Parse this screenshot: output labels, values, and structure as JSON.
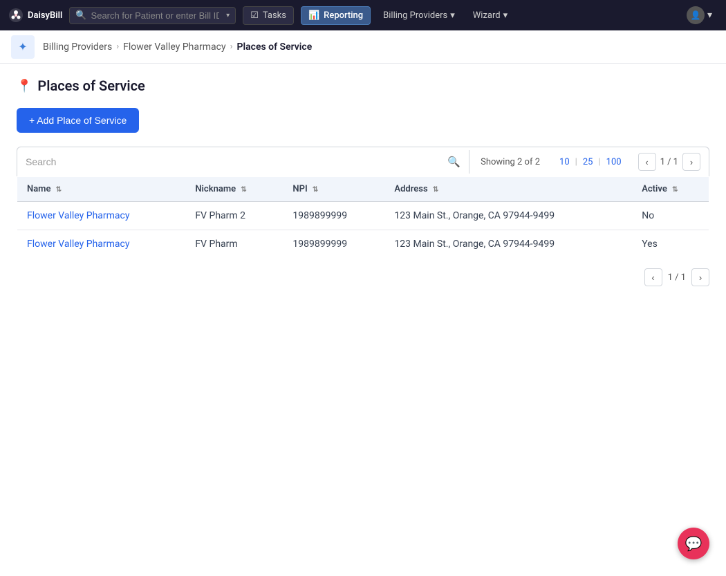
{
  "app": {
    "name": "DaisyBill"
  },
  "topnav": {
    "search_placeholder": "Search for Patient or enter Bill ID",
    "tasks_label": "Tasks",
    "reporting_label": "Reporting",
    "billing_providers_label": "Billing Providers",
    "wizard_label": "Wizard"
  },
  "breadcrumb": {
    "billing_providers": "Billing Providers",
    "pharmacy": "Flower Valley Pharmacy",
    "current": "Places of Service"
  },
  "page": {
    "title": "Places of Service",
    "add_button": "+ Add Place of Service"
  },
  "table_controls": {
    "search_placeholder": "Search",
    "showing": "Showing 2 of 2",
    "page_sizes": [
      "10",
      "25",
      "100"
    ],
    "page_current": "1 / 1"
  },
  "table": {
    "headers": [
      {
        "label": "Name",
        "key": "name"
      },
      {
        "label": "Nickname",
        "key": "nickname"
      },
      {
        "label": "NPI",
        "key": "npi"
      },
      {
        "label": "Address",
        "key": "address"
      },
      {
        "label": "Active",
        "key": "active"
      }
    ],
    "rows": [
      {
        "name": "Flower Valley Pharmacy",
        "nickname": "FV Pharm 2",
        "npi": "1989899999",
        "address": "123 Main St., Orange, CA 97944-9499",
        "active": "No"
      },
      {
        "name": "Flower Valley Pharmacy",
        "nickname": "FV Pharm",
        "npi": "1989899999",
        "address": "123 Main St., Orange, CA 97944-9499",
        "active": "Yes"
      }
    ]
  }
}
